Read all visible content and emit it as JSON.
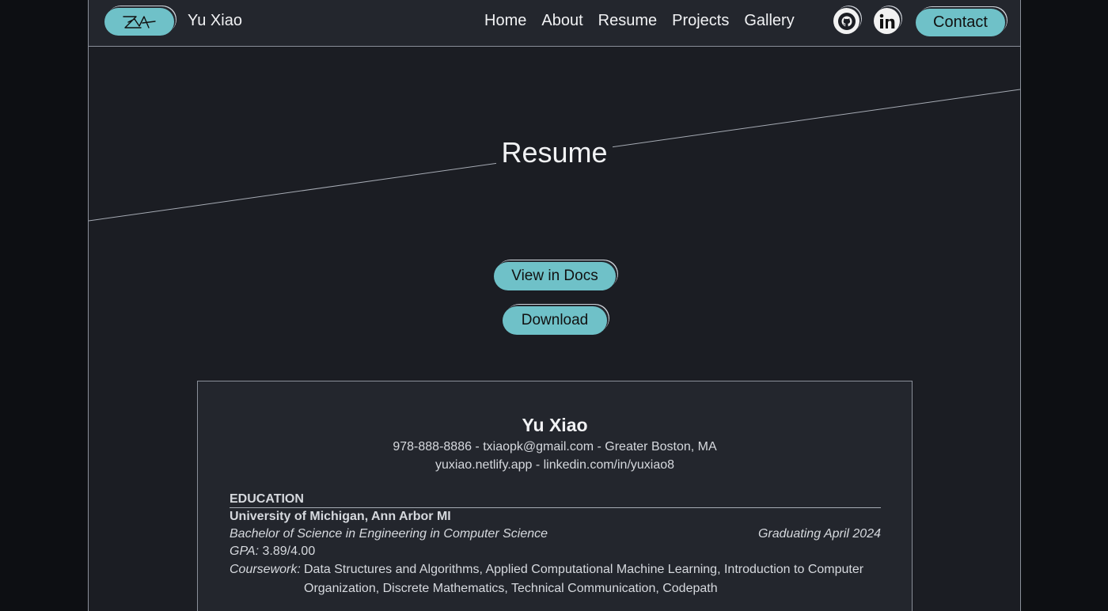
{
  "nav": {
    "logo_icon": "signature-logo-icon",
    "brand": "Yu Xiao",
    "links": [
      "Home",
      "About",
      "Resume",
      "Projects",
      "Gallery"
    ],
    "github_icon": "github-icon",
    "linkedin_icon": "linkedin-icon",
    "contact_label": "Contact"
  },
  "hero": {
    "title": "Resume",
    "view_docs_label": "View in Docs",
    "download_label": "Download"
  },
  "resume": {
    "name": "Yu Xiao",
    "contact_line": "978-888-8886 - txiaopk@gmail.com - Greater Boston, MA",
    "links_line": "yuxiao.netlify.app - linkedin.com/in/yuxiao8",
    "education": {
      "heading": "EDUCATION",
      "school": "University of Michigan, Ann Arbor MI",
      "degree": "Bachelor of Science in Engineering in Computer Science",
      "graduation": "Graduating April 2024",
      "gpa_label": "GPA:",
      "gpa_value": "3.89/4.00",
      "coursework_label": "Coursework:",
      "coursework_value": "Data Structures and Algorithms, Applied Computational Machine Learning, Introduction to Computer Organization, Discrete Mathematics, Technical Communication, Codepath"
    }
  },
  "colors": {
    "accent": "#6fc1c8",
    "background": "#1b1d23",
    "panel": "#23262d",
    "outer": "#0d0f13"
  }
}
